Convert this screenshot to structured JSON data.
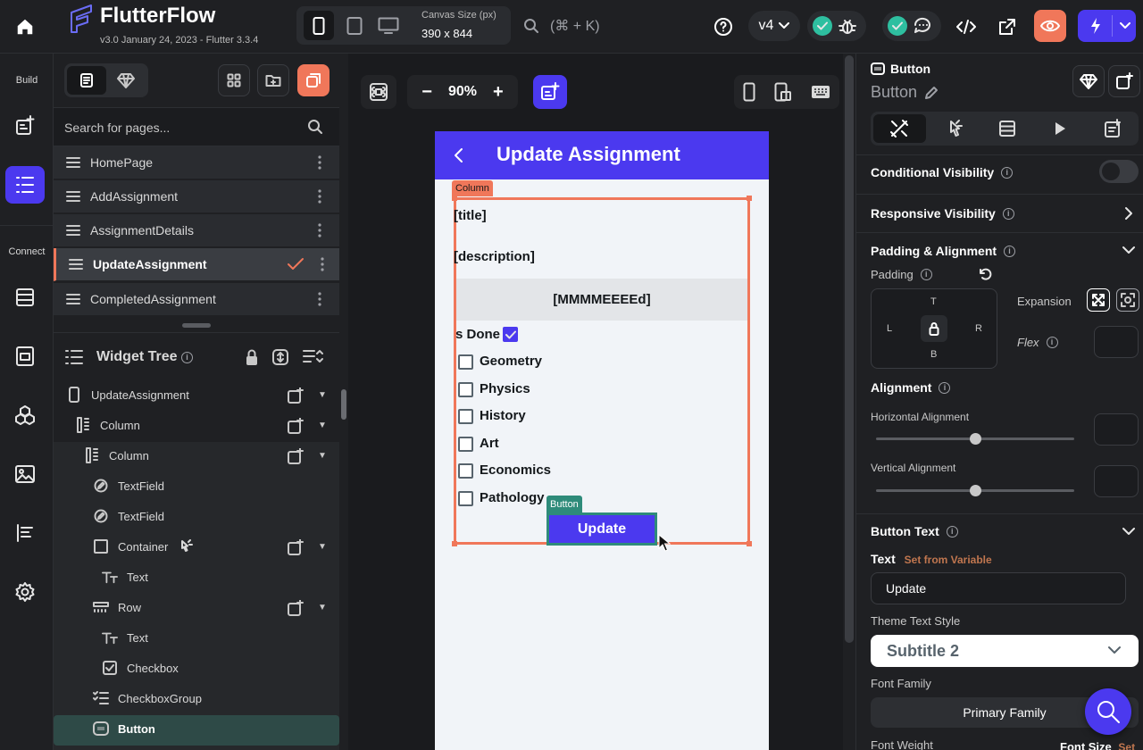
{
  "app": {
    "brand": "FlutterFlow",
    "version": "v3.0 January 24, 2023 - Flutter 3.3.4"
  },
  "topbar": {
    "canvas_size_label": "Canvas Size (px)",
    "canvas_size_value": "390 x 844",
    "search_shortcut": "(⌘ + K)",
    "version_select": "v4"
  },
  "rail": {
    "build_label": "Build",
    "connect_label": "Connect"
  },
  "pages": {
    "search_placeholder": "Search for pages...",
    "items": [
      {
        "label": "HomePage"
      },
      {
        "label": "AddAssignment"
      },
      {
        "label": "AssignmentDetails"
      },
      {
        "label": "UpdateAssignment"
      },
      {
        "label": "CompletedAssignment"
      }
    ]
  },
  "widget_tree": {
    "title": "Widget Tree",
    "nodes": [
      {
        "label": "UpdateAssignment"
      },
      {
        "label": "Column"
      },
      {
        "label": "Column"
      },
      {
        "label": "TextField"
      },
      {
        "label": "TextField"
      },
      {
        "label": "Container"
      },
      {
        "label": "Text"
      },
      {
        "label": "Row"
      },
      {
        "label": "Text"
      },
      {
        "label": "Checkbox"
      },
      {
        "label": "CheckboxGroup"
      },
      {
        "label": "Button"
      }
    ]
  },
  "canvas": {
    "zoom": "90%",
    "app_title": "Update Assignment",
    "column_tag": "Column",
    "title_text": "[title]",
    "description_text": "[description]",
    "date_text": "[MMMMEEEEd]",
    "is_done_label": "s Done",
    "subjects": [
      "Geometry",
      "Physics",
      "History",
      "Art",
      "Economics",
      "Pathology"
    ],
    "button_tag": "Button",
    "button_label": "Update"
  },
  "props": {
    "widget_type": "Button",
    "widget_name": "Button",
    "conditional_visibility": "Conditional Visibility",
    "responsive_visibility": "Responsive Visibility",
    "padding_alignment": "Padding & Alignment",
    "padding_label": "Padding",
    "pad_t": "T",
    "pad_l": "L",
    "pad_r": "R",
    "pad_b": "B",
    "expansion_label": "Expansion",
    "flex_label": "Flex",
    "alignment_label": "Alignment",
    "horizontal_alignment": "Horizontal Alignment",
    "horizontal_value": 0.5,
    "vertical_alignment": "Vertical Alignment",
    "vertical_value": 0.5,
    "button_text_section": "Button Text",
    "text_label": "Text",
    "set_from_variable": "Set from Variable",
    "text_value": "Update",
    "theme_text_style_label": "Theme Text Style",
    "theme_text_style_value": "Subtitle 2",
    "font_family_label": "Font Family",
    "font_family_value": "Primary Family",
    "font_weight_label": "Font Weight",
    "font_size_label": "Font Size",
    "font_size_set": "Set"
  },
  "colors": {
    "primary": "#4b39ef",
    "accent": "#f0775a",
    "selection": "#2e8b7a"
  }
}
